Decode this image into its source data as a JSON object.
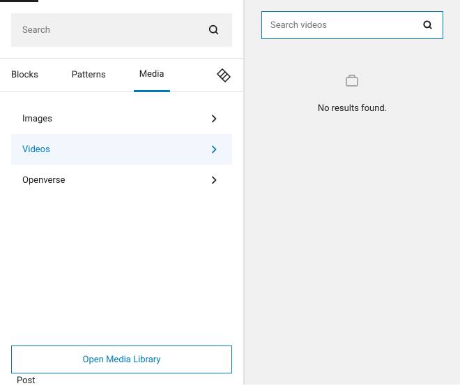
{
  "leftPanel": {
    "search": {
      "placeholder": "Search"
    },
    "tabs": {
      "blocks": "Blocks",
      "patterns": "Patterns",
      "media": "Media"
    },
    "mediaCategories": {
      "images": "Images",
      "videos": "Videos",
      "openverse": "Openverse"
    },
    "openLibraryButton": "Open Media Library",
    "postLabel": "Post"
  },
  "rightPanel": {
    "search": {
      "placeholder": "Search videos"
    },
    "noResults": "No results found."
  }
}
